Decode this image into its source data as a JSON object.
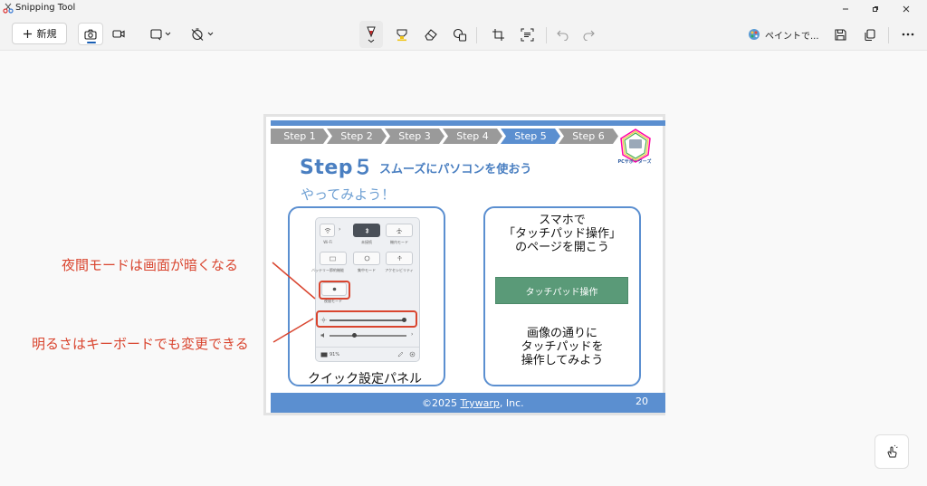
{
  "window": {
    "title": "Snipping Tool"
  },
  "toolbar": {
    "new_label": "新規",
    "paint_label": "ペイントで..."
  },
  "slide": {
    "steps": [
      "Step 1",
      "Step 2",
      "Step 3",
      "Step 4",
      "Step 5",
      "Step 6"
    ],
    "active_step": 4,
    "logo_text": "PCサポーターズ",
    "heading": "Step５",
    "subheading": "スムーズにパソコンを使おう",
    "try_label": "やってみよう！",
    "qs_labels": {
      "wifi": "Wi-Fi",
      "bluetooth": "未接続",
      "airplane": "機内モード",
      "battery": "バッテリー節約機能",
      "focus": "集中モード",
      "accessibility": "アクセシビリティ",
      "night": "夜間モード",
      "battery_pct": "91%"
    },
    "left_caption": "クイック設定パネル",
    "right_text_1": [
      "スマホで",
      "「タッチパッド操作」",
      "のページを開こう"
    ],
    "touchpad_button": "タッチパッド操作",
    "right_text_2": [
      "画像の通りに",
      "タッチパッドを",
      "操作してみよう"
    ],
    "footer_prefix": "©2025 ",
    "footer_company": "Trywarp",
    "footer_suffix": ", Inc.",
    "page_number": "20"
  },
  "annotations": {
    "night_mode": "夜間モードは画面が暗くなる",
    "brightness": "明るさはキーボードでも変更できる"
  },
  "colors": {
    "accent": "#5b8fd0",
    "annotation": "#d9452f",
    "button_green": "#5a9a78"
  }
}
